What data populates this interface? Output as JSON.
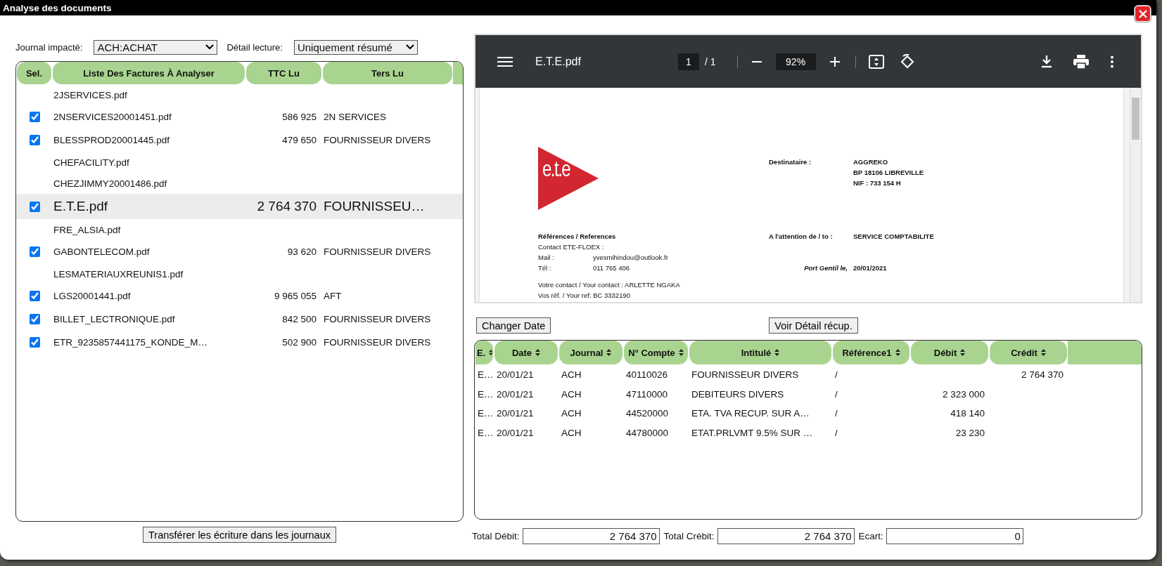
{
  "window": {
    "title": "Analyse des documents"
  },
  "filters": [
    {
      "label": "Journal impacté:",
      "value": "ACH:ACHAT"
    },
    {
      "label": "Détail lecture:",
      "value": "Uniquement résumé"
    }
  ],
  "invoices": {
    "columns": [
      "Sel.",
      "Liste Des Factures À Analyser",
      "TTC Lu",
      "Ters Lu"
    ],
    "rows": [
      {
        "name": "2JSERVICES.pdf",
        "checked": false,
        "selected": false
      },
      {
        "name": "2NSERVICES20001451.pdf",
        "ttc": "586 925",
        "tiers": "2N SERVICES",
        "checked": true,
        "selected": false
      },
      {
        "name": "BLESSPROD20001445.pdf",
        "ttc": "479 650",
        "tiers": "FOURNISSEUR DIVERS",
        "checked": true,
        "selected": false
      },
      {
        "name": "CHEFACILITY.pdf",
        "checked": false,
        "selected": false
      },
      {
        "name": "CHEZJIMMY20001486.pdf",
        "checked": false,
        "selected": false
      },
      {
        "name": "E.T.E.pdf",
        "ttc": "2 764 370",
        "tiers": "FOURNISSEU…",
        "checked": true,
        "selected": true
      },
      {
        "name": "FRE_ALSIA.pdf",
        "checked": false,
        "selected": false
      },
      {
        "name": "GABONTELECOM.pdf",
        "ttc": "93 620",
        "tiers": "FOURNISSEUR DIVERS",
        "checked": true,
        "selected": false
      },
      {
        "name": "LESMATERIAUXREUNIS1.pdf",
        "checked": false,
        "selected": false
      },
      {
        "name": "LGS20001441.pdf",
        "ttc": "9 965 055",
        "tiers": "AFT",
        "checked": true,
        "selected": false
      },
      {
        "name": "BILLET_LECTRONIQUE.pdf",
        "ttc": "842 500",
        "tiers": "FOURNISSEUR DIVERS",
        "checked": true,
        "selected": false
      },
      {
        "name": "ETR_9235857441175_KONDE_M…",
        "ttc": "502 900",
        "tiers": "FOURNISSEUR DIVERS",
        "checked": true,
        "selected": false
      }
    ]
  },
  "transfer_button": "Transférer les écriture dans les journaux",
  "viewer": {
    "file_name": "E.T.E.pdf",
    "page": "1",
    "page_count": "/ 1",
    "zoom": "92%",
    "document": {
      "logo_text": "e.t.e",
      "recipient_label": "Destinataire :",
      "recipient_lines": [
        "AGGREKO",
        "BP 18106 LIBREVILLE",
        "NIF : 733 154 H"
      ],
      "references_title": "Références / References",
      "attention_label": "A l'attention de / to :",
      "attention_value": "SERVICE COMPTABILITE",
      "contact_title": "Contact ETE-FLOEX :",
      "contacts": [
        {
          "label": "Mail :",
          "value": "yvesmihindou@outlook.fr"
        },
        {
          "label": "Tél :",
          "value": "011 765 406"
        }
      ],
      "place": "Port Gentil  le,",
      "date": "20/01/2021",
      "your_contact": "Votre contact / Your contact : ARLETTE NGAKA",
      "your_ref": "Vos réf. / Your ref: BC 3332190"
    }
  },
  "actions": [
    "Changer Date",
    "Voir Détail récup."
  ],
  "entries": {
    "columns": [
      "E.",
      "Date",
      "Journal",
      "N° Compte",
      "Intitulé",
      "Référence1",
      "Débit",
      "Crédit"
    ],
    "rows": [
      {
        "e": "E…",
        "date": "20/01/21",
        "journal": "ACH",
        "account": "40110026",
        "label": "FOURNISSEUR DIVERS",
        "reference": "/",
        "credit": "2 764 370"
      },
      {
        "e": "E…",
        "date": "20/01/21",
        "journal": "ACH",
        "account": "47110000",
        "label": "DEBITEURS DIVERS",
        "reference": "/",
        "debit": "2 323 000"
      },
      {
        "e": "E…",
        "date": "20/01/21",
        "journal": "ACH",
        "account": "44520000",
        "label": "ETA. TVA RECUP. SUR A…",
        "reference": "/",
        "debit": "418 140"
      },
      {
        "e": "E…",
        "date": "20/01/21",
        "journal": "ACH",
        "account": "44780000",
        "label": "ETAT.PRLVMT 9.5% SUR …",
        "reference": "/",
        "debit": "23 230"
      }
    ]
  },
  "totals": [
    {
      "label": "Total Débit:",
      "value": "2 764 370"
    },
    {
      "label": "Total Crébit:",
      "value": "2 764 370"
    },
    {
      "label": "Ecart:",
      "value": "0"
    }
  ]
}
